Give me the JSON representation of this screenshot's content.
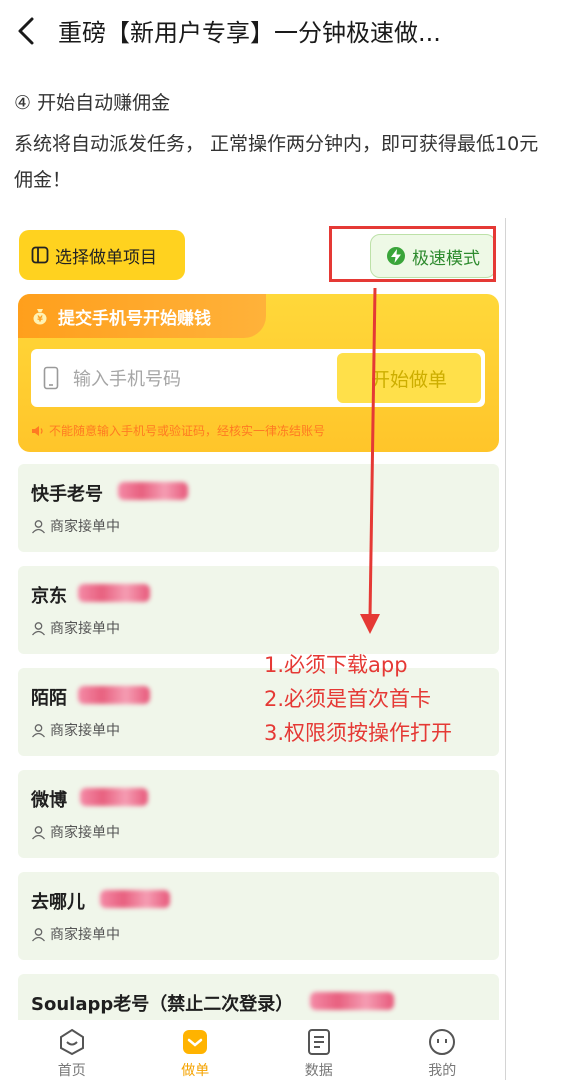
{
  "header": {
    "title": "重磅【新用户专享】一分钟极速做..."
  },
  "article": {
    "step": "④ 开始自动赚佣金",
    "description": "系统将自动派发任务，  正常操作两分钟内，即可获得最低10元佣金！"
  },
  "app": {
    "choose_project_label": "选择做单项目",
    "fast_mode_label": "极速模式",
    "card_title": "提交手机号开始赚钱",
    "phone_placeholder": "输入手机号码",
    "start_button": "开始做单",
    "warning": "不能随意输入手机号或验证码，经核实一律冻结账号",
    "tasks": [
      {
        "name": "快手老号",
        "status": "商家接单中"
      },
      {
        "name": "京东",
        "status": "商家接单中"
      },
      {
        "name": "陌陌",
        "status": "商家接单中"
      },
      {
        "name": "微博",
        "status": "商家接单中"
      },
      {
        "name": "去哪儿",
        "status": "商家接单中"
      },
      {
        "name": "Soulapp老号（禁止二次登录）",
        "status": ""
      }
    ],
    "annotation": [
      "1.必须下载app",
      "2.必须是首次首卡",
      "3.权限须按操作打开"
    ],
    "nav": [
      {
        "label": "首页",
        "icon": "home-icon"
      },
      {
        "label": "做单",
        "icon": "order-icon"
      },
      {
        "label": "数据",
        "icon": "data-icon"
      },
      {
        "label": "我的",
        "icon": "profile-icon"
      }
    ],
    "active_nav": "做单"
  },
  "colors": {
    "accent_yellow": "#ffd21f",
    "orange": "#ff9f1c",
    "green": "#2e8b2e",
    "annotation_red": "#e53935"
  }
}
